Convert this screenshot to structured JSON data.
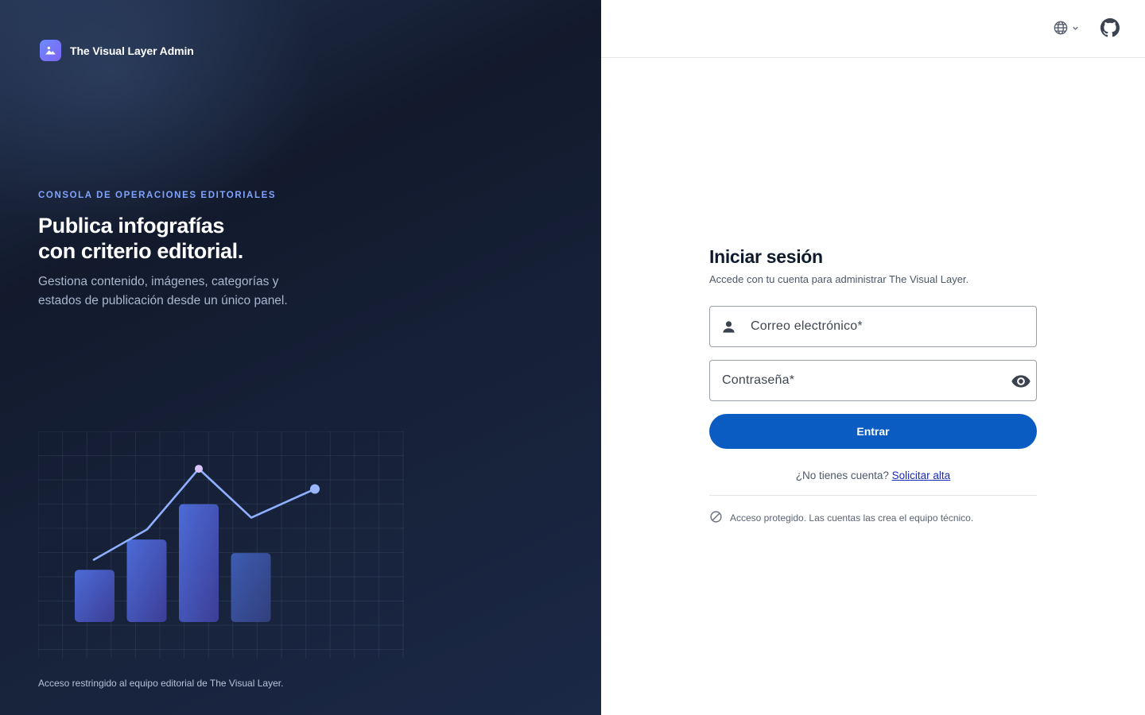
{
  "brand": {
    "name": "The Visual Layer Admin",
    "logo_icon": "image-icon"
  },
  "hero": {
    "eyebrow": "CONSOLA DE OPERACIONES EDITORIALES",
    "headline_line1": "Publica infografías",
    "headline_line2": "con criterio editorial.",
    "subtext": "Gestiona contenido, imágenes, categorías y estados de publicación desde un único panel."
  },
  "footnote": "Acceso restringido al equipo editorial de The Visual Layer.",
  "topbar": {
    "language_icon": "globe-icon",
    "github_icon": "github-icon"
  },
  "login": {
    "title": "Iniciar sesión",
    "subtitle": "Accede con tu cuenta para administrar The Visual Layer.",
    "email_placeholder": "Correo electrónico*",
    "password_placeholder": "Contraseña*",
    "submit_label": "Entrar",
    "signup_prompt": "¿No tienes cuenta?",
    "signup_link": "Solicitar alta",
    "notice": "Acceso protegido. Las cuentas las crea el equipo técnico."
  },
  "colors": {
    "accent": "#0a5cc2",
    "eyebrow": "#7fa3ff",
    "panel_dark": "#121a2c"
  },
  "chart_data": {
    "type": "bar",
    "bars": [
      0.31,
      0.49,
      0.7,
      0.41
    ],
    "line": [
      0.37,
      0.55,
      0.91,
      0.62,
      0.79
    ],
    "ylim": [
      0,
      1
    ],
    "grid": true
  }
}
